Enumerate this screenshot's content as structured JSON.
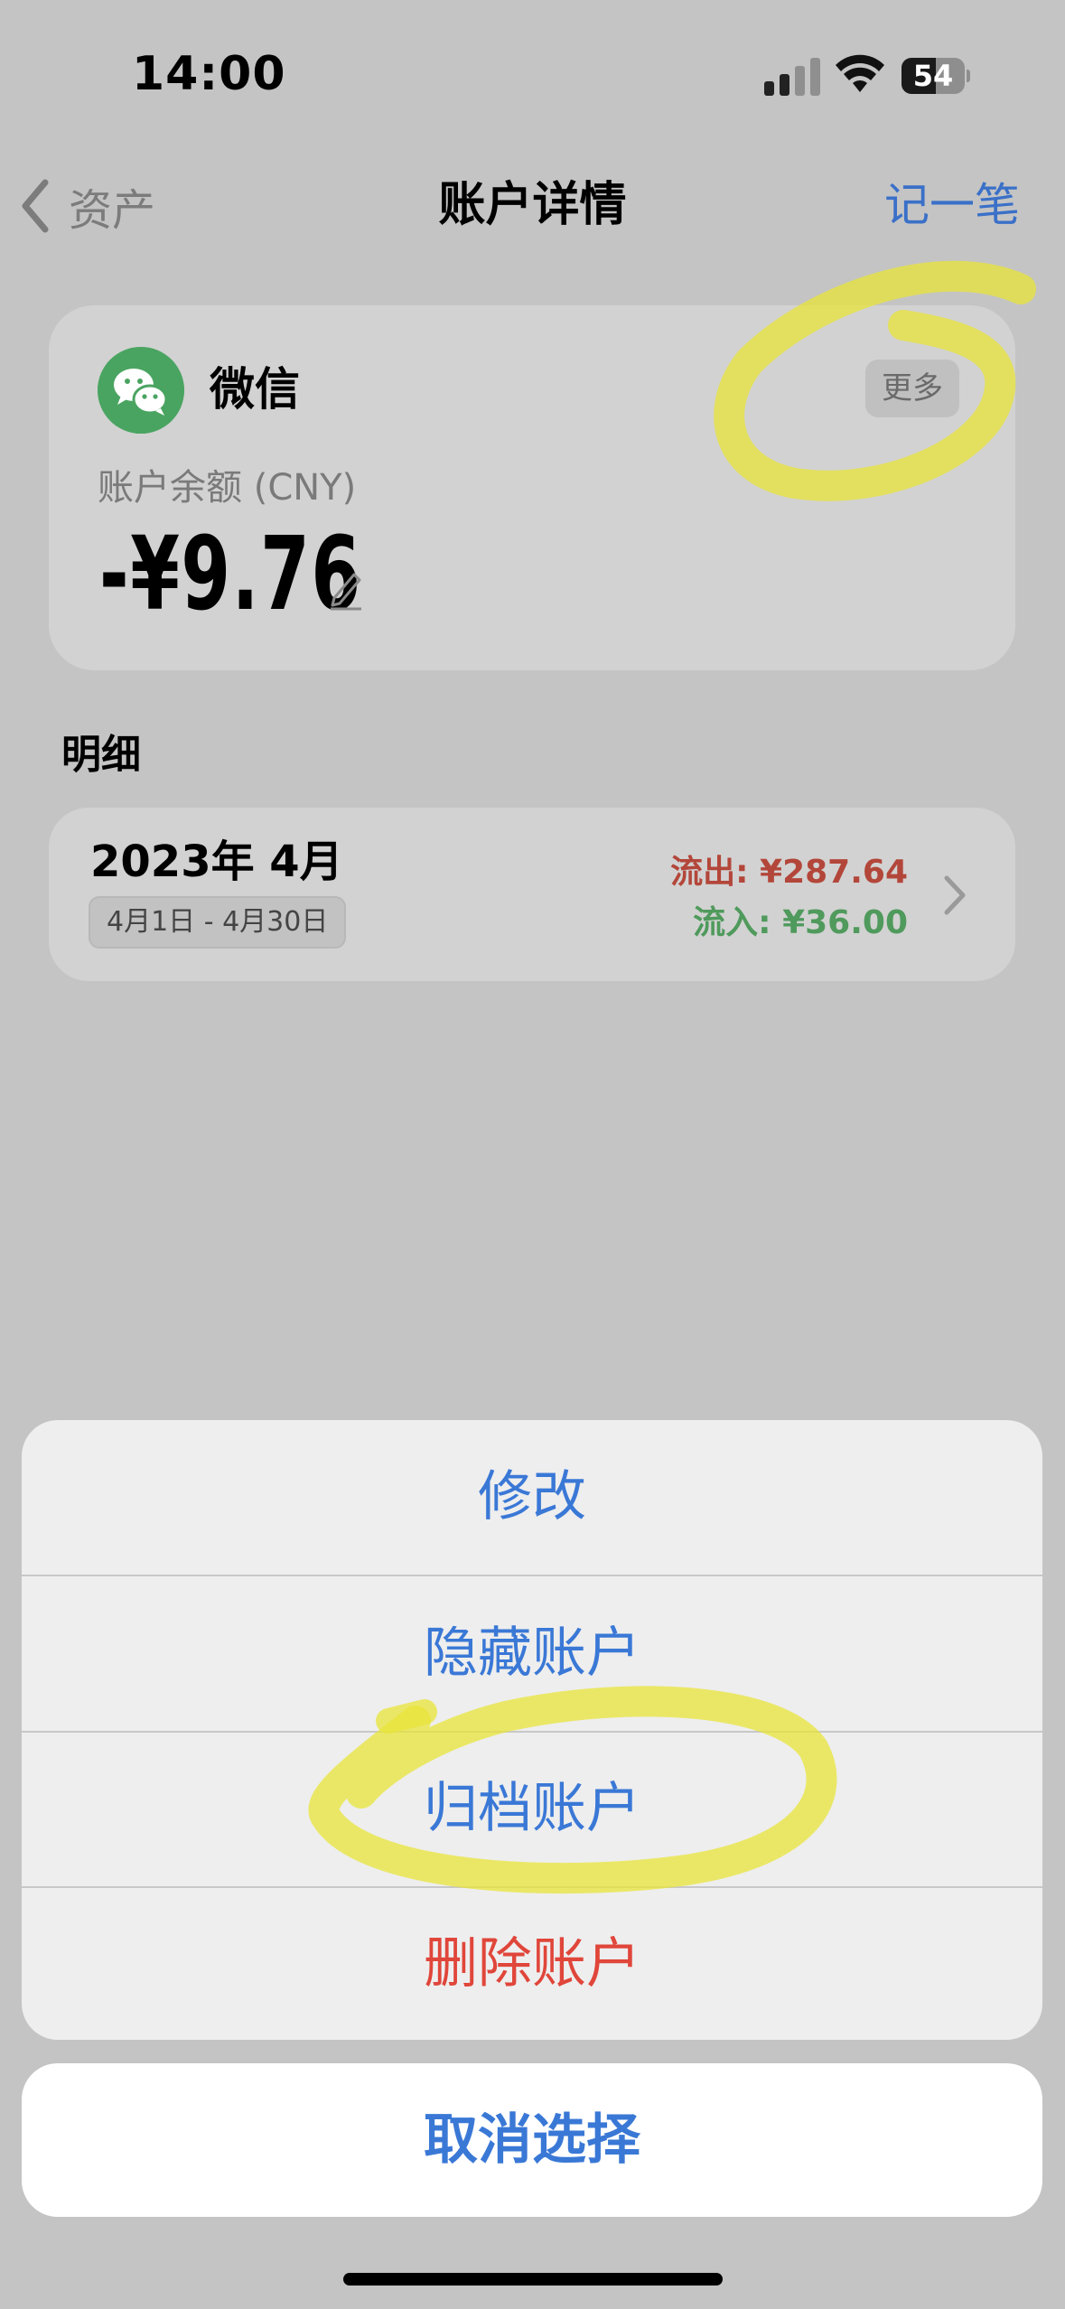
{
  "status_bar": {
    "time": "14:00",
    "battery": "54",
    "battery_level": 0.54
  },
  "nav": {
    "back_label": "资产",
    "title": "账户详情",
    "action_label": "记一笔"
  },
  "account": {
    "name": "微信",
    "more_label": "更多",
    "balance_label": "账户余额 (CNY)",
    "balance_value": "-¥9.76",
    "icons": {
      "badge": "wechat-icon",
      "edit": "pencil-icon"
    }
  },
  "details": {
    "heading": "明细",
    "rows": [
      {
        "month": "2023年 4月",
        "range": "4月1日 - 4月30日",
        "outflow": "流出: ¥287.64",
        "inflow": "流入: ¥36.00"
      }
    ]
  },
  "action_sheet": {
    "items": [
      "修改",
      "隐藏账户",
      "归档账户",
      "删除账户"
    ],
    "cancel_label": "取消选择"
  },
  "colors": {
    "accent": "#3a78d6",
    "danger": "#e0463a",
    "outflow": "#b3463a",
    "inflow": "#4f9a5c",
    "wechat": "#4aa461",
    "highlighter": "#e8e43a"
  }
}
